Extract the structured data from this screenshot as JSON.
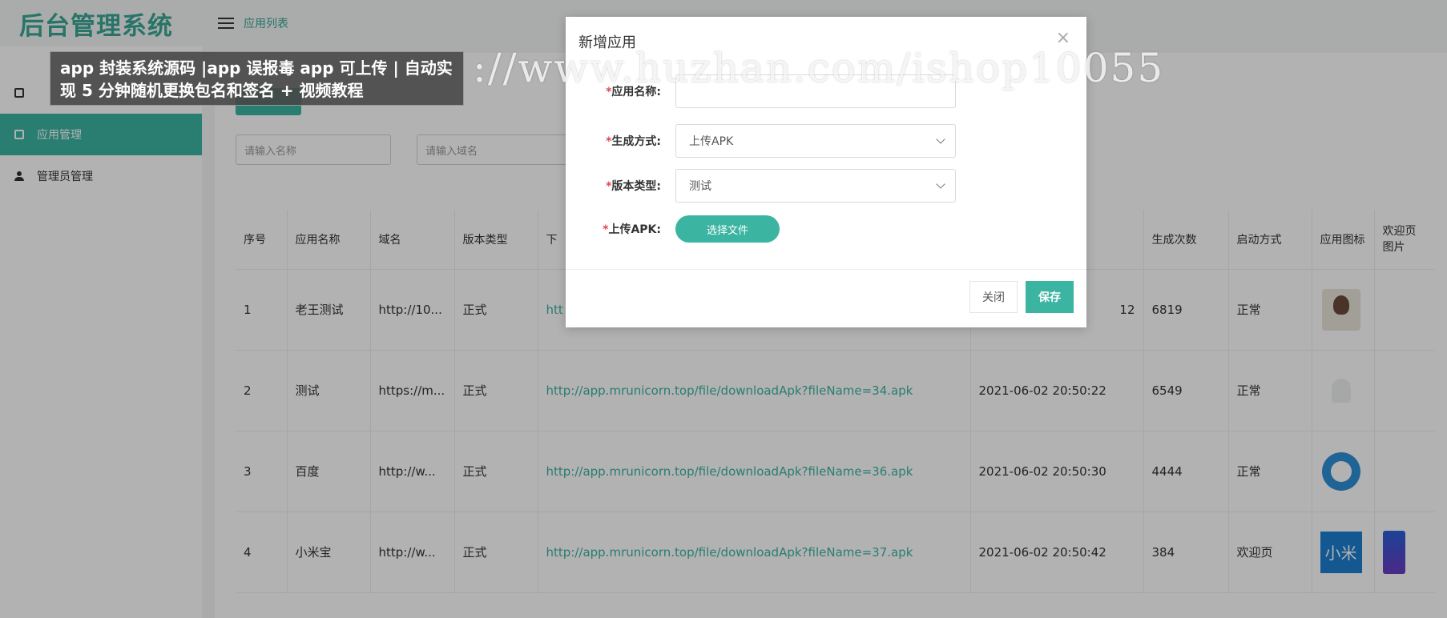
{
  "brand": {
    "title": "后台管理系统"
  },
  "topbar": {
    "breadcrumb": "应用列表"
  },
  "sidebar": {
    "items": [
      {
        "label": "应用管理"
      },
      {
        "label": "管理员管理"
      }
    ]
  },
  "filters": {
    "name_placeholder": "请输入名称",
    "domain_placeholder": "请输入域名"
  },
  "table": {
    "headers": [
      "序号",
      "应用名称",
      "域名",
      "版本类型",
      "下",
      "生成次数",
      "启动方式",
      "应用图标",
      "欢迎页图片"
    ],
    "rows": [
      {
        "index": "1",
        "name": "老王测试",
        "domain": "http://10...",
        "version": "正式",
        "download": "htt",
        "time": "12",
        "count": "6819",
        "launch": "正常",
        "icon": "avatar-icon"
      },
      {
        "index": "2",
        "name": "测试",
        "domain": "https://m...",
        "version": "正式",
        "download": "http://app.mrunicorn.top/file/downloadApk?fileName=34.apk",
        "time": "2021-06-02 20:50:22",
        "count": "6549",
        "launch": "正常",
        "icon": "ghost-icon"
      },
      {
        "index": "3",
        "name": "百度",
        "domain": "http://w...",
        "version": "正式",
        "download": "http://app.mrunicorn.top/file/downloadApk?fileName=36.apk",
        "time": "2021-06-02 20:50:30",
        "count": "4444",
        "launch": "正常",
        "icon": "qq-icon"
      },
      {
        "index": "4",
        "name": "小米宝",
        "domain": "http://w...",
        "version": "正式",
        "download": "http://app.mrunicorn.top/file/downloadApk?fileName=37.apk",
        "time": "2021-06-02 20:50:42",
        "count": "384",
        "launch": "欢迎页",
        "icon": "mi-icon",
        "icon_text": "小米"
      }
    ]
  },
  "modal": {
    "title": "新增应用",
    "close_glyph": "×",
    "fields": {
      "app_name_label": "应用名称:",
      "gen_mode_label": "生成方式:",
      "gen_mode_value": "上传APK",
      "version_label": "版本类型:",
      "version_value": "测试",
      "upload_label": "上传APK:",
      "upload_button": "选择文件"
    },
    "buttons": {
      "close": "关闭",
      "save": "保存"
    }
  },
  "overlay": {
    "caption": "app 封装系统源码 |app 误报毒 app 可上传 | 自动实现 5 分钟随机更换包名和签名 + 视频教程",
    "url": "://www.huzhan.com/ishop10055"
  },
  "colors": {
    "accent": "#3bb4a2",
    "required": "#e5484d"
  }
}
